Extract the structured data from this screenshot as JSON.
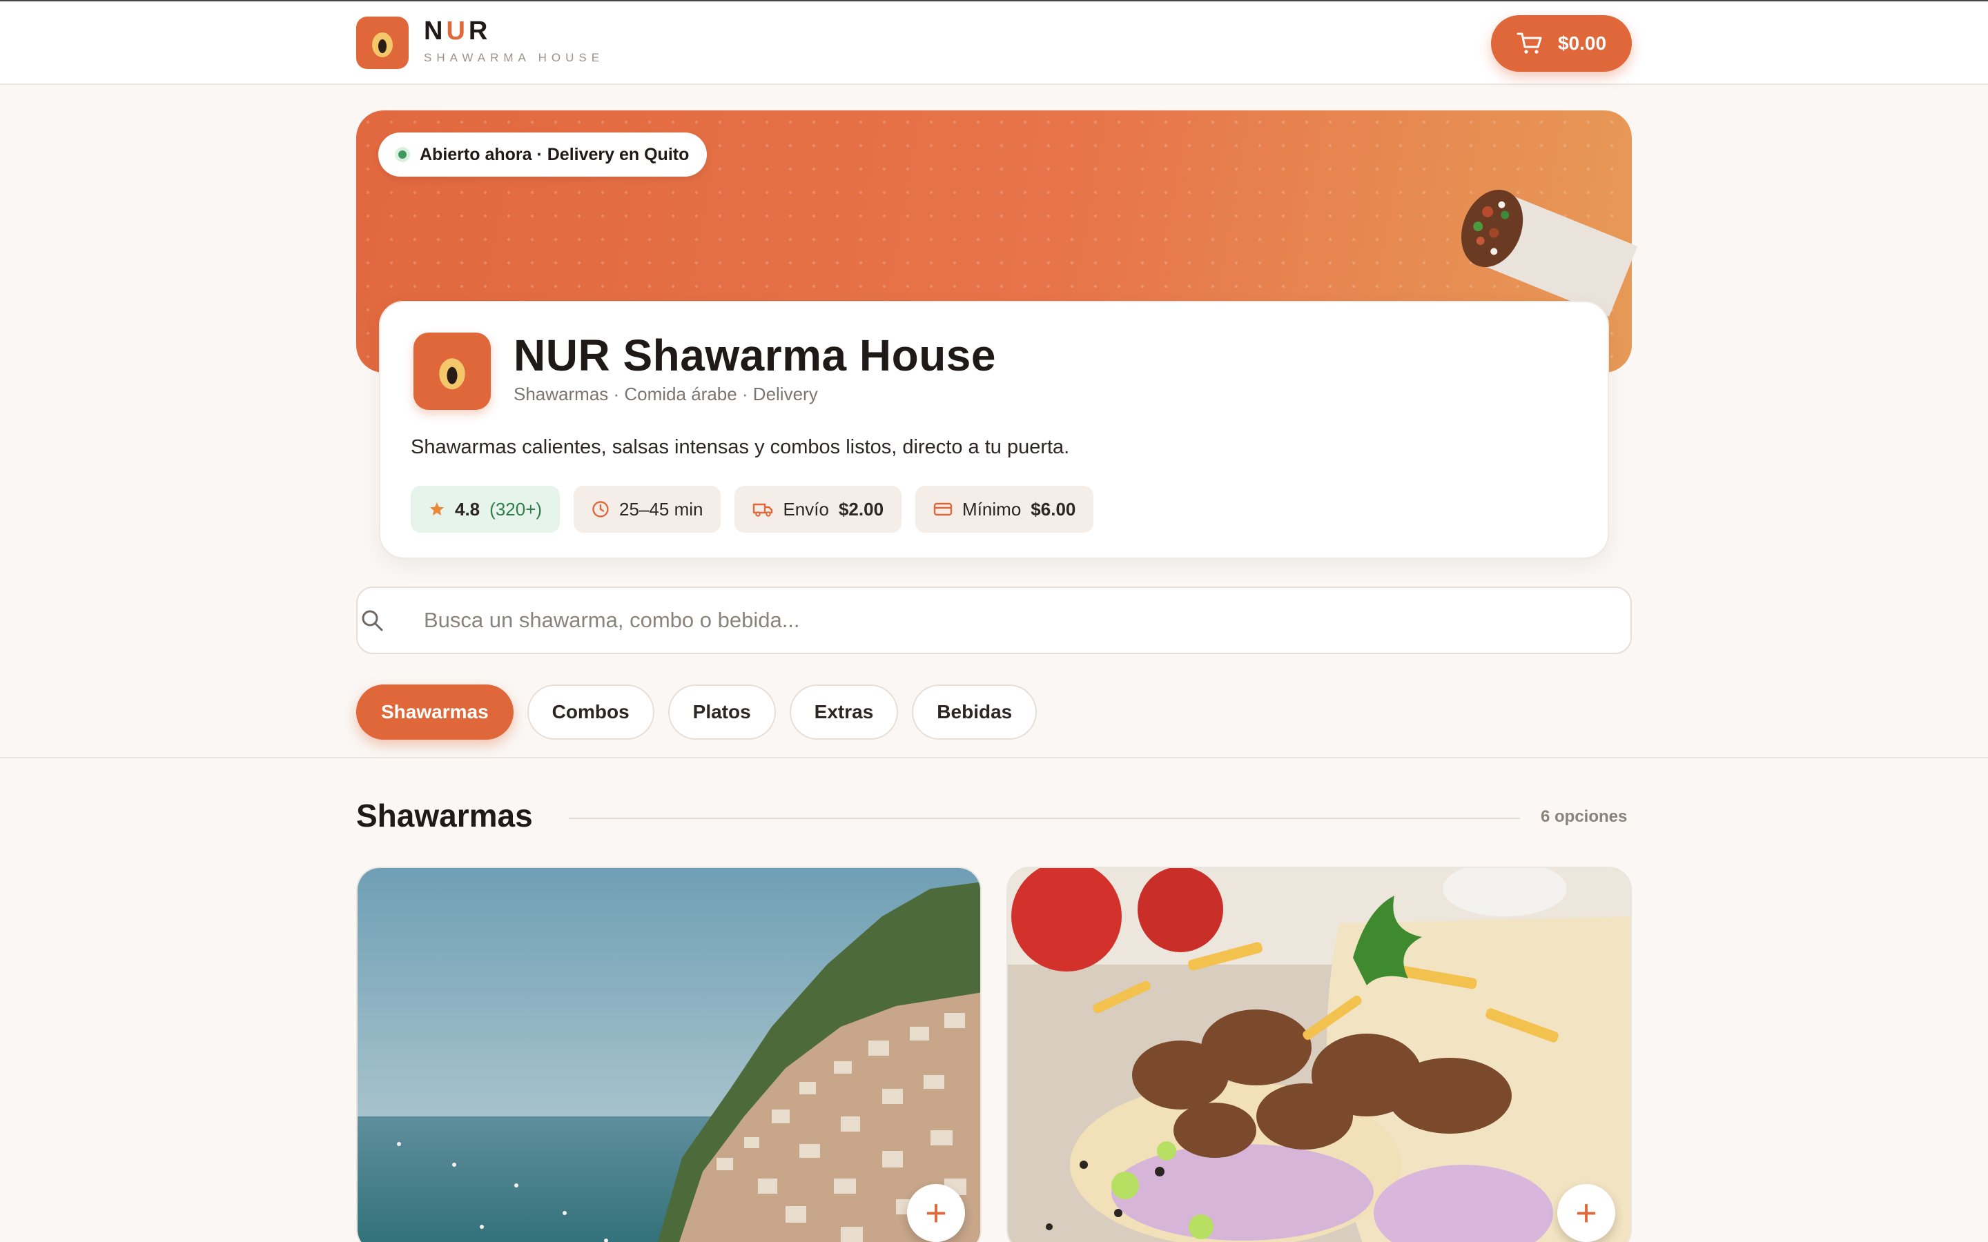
{
  "header": {
    "brand_prefix": "N",
    "brand_accent": "U",
    "brand_suffix": "R",
    "brand_subtitle": "SHAWARMA HOUSE",
    "cart_total": "$0.00",
    "cart_icon": "cart-icon"
  },
  "hero": {
    "status": "Abierto ahora · Delivery en Quito"
  },
  "restaurant": {
    "name": "NUR Shawarma House",
    "categories": "Shawarmas · Comida árabe · Delivery",
    "description": "Shawarmas calientes, salsas intensas y combos listos, directo a tu puerta.",
    "rating": "4.8",
    "rating_count": "(320+)",
    "delivery_time": "25–45 min",
    "shipping_label": "Envío",
    "shipping_value": "$2.00",
    "minimum_label": "Mínimo",
    "minimum_value": "$6.00"
  },
  "search": {
    "placeholder": "Busca un shawarma, combo o bebida..."
  },
  "tabs": [
    {
      "label": "Shawarmas",
      "active": true
    },
    {
      "label": "Combos",
      "active": false
    },
    {
      "label": "Platos",
      "active": false
    },
    {
      "label": "Extras",
      "active": false
    },
    {
      "label": "Bebidas",
      "active": false
    }
  ],
  "section": {
    "title": "Shawarmas",
    "count": "6 opciones"
  },
  "products": [
    {
      "add_label": "+"
    },
    {
      "add_label": "+"
    }
  ],
  "colors": {
    "accent": "#e0673a",
    "background": "#faf7f4",
    "open_status": "#3e9a5c"
  }
}
